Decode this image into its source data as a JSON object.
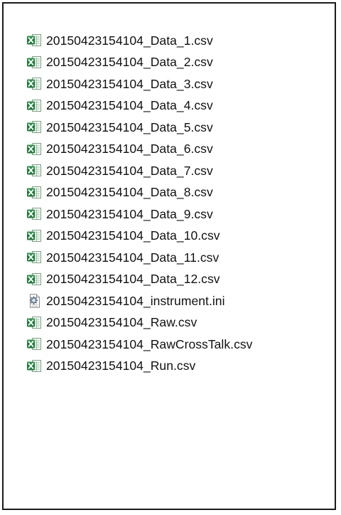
{
  "explorer": {
    "files": [
      {
        "name": "20150423154104_Data_1.csv",
        "icon": "csv-excel-file-icon"
      },
      {
        "name": "20150423154104_Data_2.csv",
        "icon": "csv-excel-file-icon"
      },
      {
        "name": "20150423154104_Data_3.csv",
        "icon": "csv-excel-file-icon"
      },
      {
        "name": "20150423154104_Data_4.csv",
        "icon": "csv-excel-file-icon"
      },
      {
        "name": "20150423154104_Data_5.csv",
        "icon": "csv-excel-file-icon"
      },
      {
        "name": "20150423154104_Data_6.csv",
        "icon": "csv-excel-file-icon"
      },
      {
        "name": "20150423154104_Data_7.csv",
        "icon": "csv-excel-file-icon"
      },
      {
        "name": "20150423154104_Data_8.csv",
        "icon": "csv-excel-file-icon"
      },
      {
        "name": "20150423154104_Data_9.csv",
        "icon": "csv-excel-file-icon"
      },
      {
        "name": "20150423154104_Data_10.csv",
        "icon": "csv-excel-file-icon"
      },
      {
        "name": "20150423154104_Data_11.csv",
        "icon": "csv-excel-file-icon"
      },
      {
        "name": "20150423154104_Data_12.csv",
        "icon": "csv-excel-file-icon"
      },
      {
        "name": "20150423154104_instrument.ini",
        "icon": "ini-settings-file-icon"
      },
      {
        "name": "20150423154104_Raw.csv",
        "icon": "csv-excel-file-icon"
      },
      {
        "name": "20150423154104_RawCrossTalk.csv",
        "icon": "csv-excel-file-icon"
      },
      {
        "name": "20150423154104_Run.csv",
        "icon": "csv-excel-file-icon"
      }
    ]
  },
  "colors": {
    "excel_green": "#1f7a3a",
    "border": "#1a1a1a",
    "text": "#111111"
  }
}
